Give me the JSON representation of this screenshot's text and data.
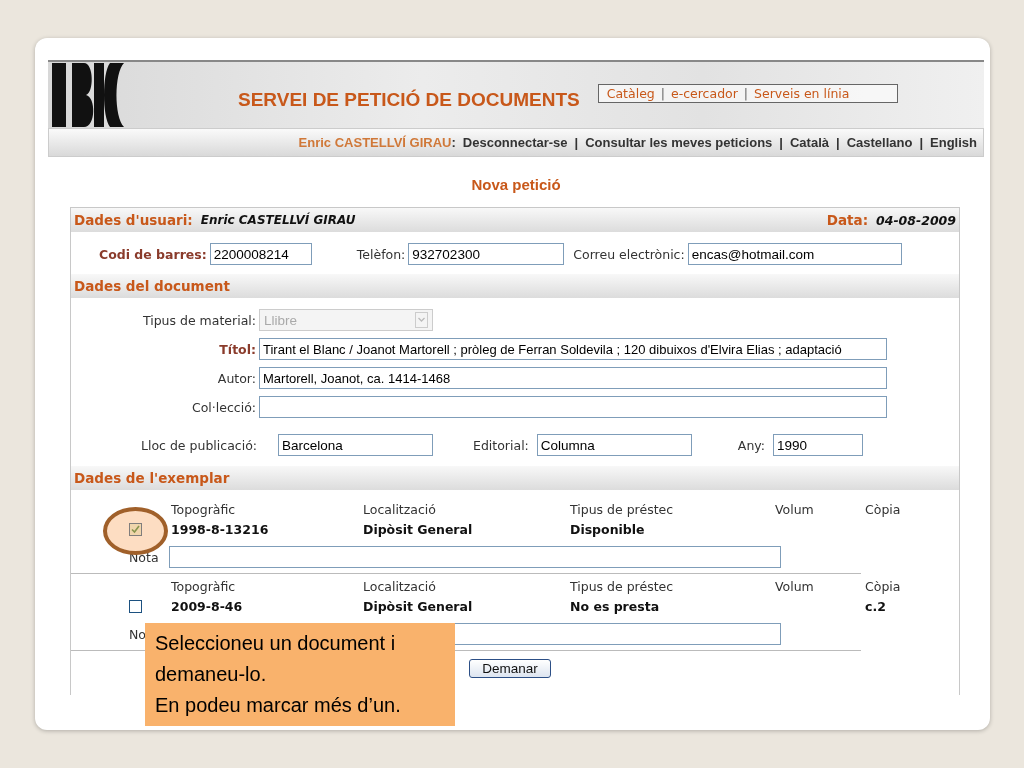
{
  "header": {
    "title": "SERVEI DE PETICIÓ DE DOCUMENTS",
    "links": [
      "Catàleg",
      "e-cercador",
      "Serveis en línia"
    ],
    "separator": "|"
  },
  "nav": {
    "user": "Enric CASTELLVÍ GIRAU",
    "user_colon": ":",
    "items": [
      "Desconnectar-se",
      "Consultar les meves peticions",
      "Català",
      "Castellano",
      "English"
    ],
    "separator": "|"
  },
  "page_title": "Nova petició",
  "user_section": {
    "title": "Dades d'usuari:",
    "name": "Enric CASTELLVÍ GIRAU",
    "date_label": "Data:",
    "date": "04-08-2009",
    "fields": [
      {
        "label": "Codi de barres:",
        "value": "2200008214",
        "required": true
      },
      {
        "label": "Telèfon:",
        "value": "932702300",
        "required": false
      },
      {
        "label": "Correu electrònic:",
        "value": "encas@hotmail.com",
        "required": false
      }
    ]
  },
  "document_section": {
    "title": "Dades del document",
    "material": {
      "label": "Tipus de material:",
      "value": "Llibre",
      "disabled": true
    },
    "fields": [
      {
        "label": "Títol:",
        "value": "Tirant el Blanc / Joanot Martorell ; pròleg de Ferran Soldevila ; 120 dibuixos d'Elvira Elias ; adaptació",
        "required": true
      },
      {
        "label": "Autor:",
        "value": "Martorell, Joanot, ca. 1414-1468",
        "required": false
      },
      {
        "label": "Col·lecció:",
        "required": false
      }
    ],
    "publication": [
      {
        "label": "Lloc de publicació:",
        "value": "Barcelona"
      },
      {
        "label": "Editorial:",
        "value": "Columna"
      },
      {
        "label": "Any:",
        "value": "1990"
      }
    ]
  },
  "copies_section": {
    "title": "Dades de l'exemplar",
    "copies": [
      {
        "checked": true,
        "highlighted": true,
        "columns": [
          {
            "header": "Topogràfic",
            "value": "1998-8-13216"
          },
          {
            "header": "Localització",
            "value": "Dipòsit General"
          },
          {
            "header": "Tipus de préstec",
            "value": "Disponible"
          },
          {
            "header": "Volum"
          },
          {
            "header": "Còpia"
          }
        ],
        "note_label": "Nota"
      },
      {
        "checked": false,
        "highlighted": false,
        "columns": [
          {
            "header": "Topogràfic",
            "value": "2009-8-46"
          },
          {
            "header": "Localització",
            "value": "Dipòsit General"
          },
          {
            "header": "Tipus de préstec",
            "value": "No es presta"
          },
          {
            "header": "Volum"
          },
          {
            "header": "Còpia",
            "value": "c.2"
          }
        ],
        "note_label": "No"
      }
    ]
  },
  "submit": "Demanar",
  "callout": {
    "lines": [
      "Seleccioneu un document i",
      "demaneu-lo.",
      "En podeu marcar més d’un."
    ]
  }
}
